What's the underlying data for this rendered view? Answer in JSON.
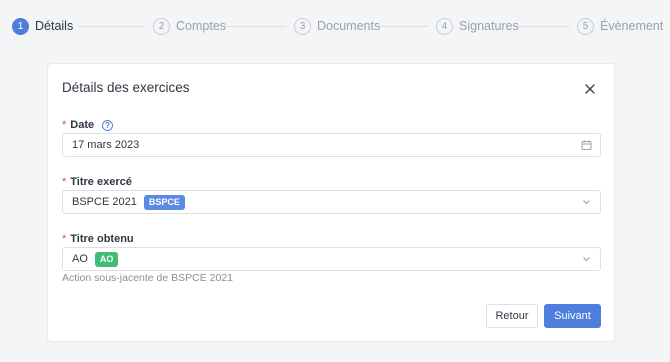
{
  "stepper": {
    "steps": [
      {
        "num": "1",
        "label": "Détails"
      },
      {
        "num": "2",
        "label": "Comptes"
      },
      {
        "num": "3",
        "label": "Documents"
      },
      {
        "num": "4",
        "label": "Signatures"
      },
      {
        "num": "5",
        "label": "Évènement"
      }
    ],
    "active_step": 1
  },
  "modal": {
    "title": "Détails des exercices",
    "fields": {
      "date": {
        "label": "Date",
        "required_mark": "*",
        "help_glyph": "?",
        "value": "17 mars 2023"
      },
      "titre_exerce": {
        "label": "Titre exercé",
        "required_mark": "*",
        "value": "BSPCE 2021",
        "tag": "BSPCE"
      },
      "titre_obtenu": {
        "label": "Titre obtenu",
        "required_mark": "*",
        "value": "AO",
        "tag": "AO",
        "hint": "Action sous-jacente de BSPCE 2021"
      }
    },
    "buttons": {
      "back": "Retour",
      "next": "Suivant"
    }
  },
  "colors": {
    "accent": "#4e7fdc",
    "required": "#e0483f",
    "tag_blue": "#5b8ae6",
    "tag_green": "#3fbd72"
  },
  "icons": {
    "close": "close-icon",
    "calendar": "calendar-icon",
    "help": "help-circle-icon",
    "chevron": "chevron-down-icon"
  }
}
